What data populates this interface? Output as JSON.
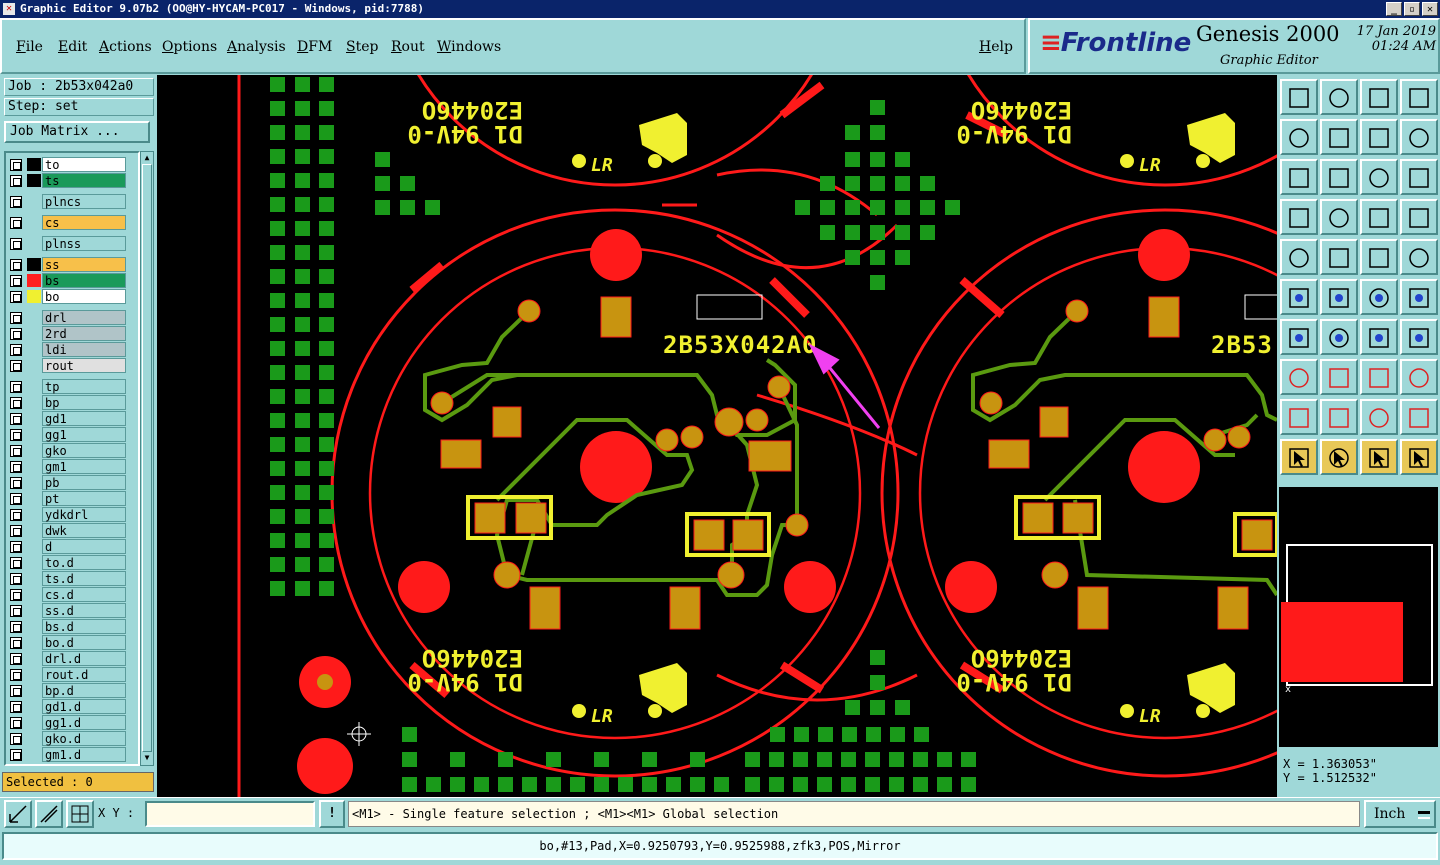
{
  "window": {
    "title": "Graphic Editor 9.07b2 (OO@HY-HYCAM-PC017 - Windows, pid:7788)",
    "min_label": "_",
    "max_label": "▫",
    "close_label": "✕"
  },
  "menu": {
    "file": "File",
    "edit": "Edit",
    "actions": "Actions",
    "options": "Options",
    "analysis": "Analysis",
    "dfm": "DFM",
    "step": "Step",
    "rout": "Rout",
    "windows": "Windows",
    "help": "Help"
  },
  "brand": {
    "logo": "Frontline",
    "product": "Genesis 2000",
    "subtitle": "Graphic Editor",
    "date": "17 Jan 2019",
    "time": "01:24 AM"
  },
  "job": {
    "job": "Job : 2b53x042a0",
    "step": "Step: set",
    "matrix_button": "Job Matrix ..."
  },
  "layers": [
    {
      "name": "to",
      "bg": "#ffffff",
      "swatch": "#000000"
    },
    {
      "name": "ts",
      "bg": "#1a9a5a",
      "swatch": "#000000"
    },
    {
      "name": "plncs",
      "bg": "#9fd8d8",
      "swatch": ""
    },
    {
      "name": "cs",
      "bg": "#f7c04a",
      "swatch": ""
    },
    {
      "name": "plnss",
      "bg": "#9fd8d8",
      "swatch": ""
    },
    {
      "name": "ss",
      "bg": "#f7c04a",
      "swatch": "#000000"
    },
    {
      "name": "bs",
      "bg": "#1a9a5a",
      "swatch": "#ff2020"
    },
    {
      "name": "bo",
      "bg": "#ffffff",
      "swatch": "#f0f030"
    },
    {
      "name": "drl",
      "bg": "#b0c4c8",
      "swatch": ""
    },
    {
      "name": "2rd",
      "bg": "#b0c4c8",
      "swatch": ""
    },
    {
      "name": "ldi",
      "bg": "#b0c4c8",
      "swatch": ""
    },
    {
      "name": "rout",
      "bg": "#e0e0e0",
      "swatch": ""
    },
    {
      "name": "tp",
      "bg": "#9fd8d8",
      "swatch": ""
    },
    {
      "name": "bp",
      "bg": "#9fd8d8",
      "swatch": ""
    },
    {
      "name": "gd1",
      "bg": "#9fd8d8",
      "swatch": ""
    },
    {
      "name": "gg1",
      "bg": "#9fd8d8",
      "swatch": ""
    },
    {
      "name": "gko",
      "bg": "#9fd8d8",
      "swatch": ""
    },
    {
      "name": "gm1",
      "bg": "#9fd8d8",
      "swatch": ""
    },
    {
      "name": "pb",
      "bg": "#9fd8d8",
      "swatch": ""
    },
    {
      "name": "pt",
      "bg": "#9fd8d8",
      "swatch": ""
    },
    {
      "name": "ydkdrl",
      "bg": "#9fd8d8",
      "swatch": ""
    },
    {
      "name": "dwk",
      "bg": "#9fd8d8",
      "swatch": ""
    },
    {
      "name": "d",
      "bg": "#9fd8d8",
      "swatch": ""
    },
    {
      "name": "to.d",
      "bg": "#9fd8d8",
      "swatch": ""
    },
    {
      "name": "ts.d",
      "bg": "#9fd8d8",
      "swatch": ""
    },
    {
      "name": "cs.d",
      "bg": "#9fd8d8",
      "swatch": ""
    },
    {
      "name": "ss.d",
      "bg": "#9fd8d8",
      "swatch": ""
    },
    {
      "name": "bs.d",
      "bg": "#9fd8d8",
      "swatch": ""
    },
    {
      "name": "bo.d",
      "bg": "#9fd8d8",
      "swatch": ""
    },
    {
      "name": "drl.d",
      "bg": "#9fd8d8",
      "swatch": ""
    },
    {
      "name": "rout.d",
      "bg": "#9fd8d8",
      "swatch": ""
    },
    {
      "name": "bp.d",
      "bg": "#9fd8d8",
      "swatch": ""
    },
    {
      "name": "gd1.d",
      "bg": "#9fd8d8",
      "swatch": ""
    },
    {
      "name": "gg1.d",
      "bg": "#9fd8d8",
      "swatch": ""
    },
    {
      "name": "gko.d",
      "bg": "#9fd8d8",
      "swatch": ""
    },
    {
      "name": "gm1.d",
      "bg": "#9fd8d8",
      "swatch": ""
    }
  ],
  "selected": "Selected : 0",
  "board": {
    "marking": "E20446O",
    "rating": "D1 94V-0",
    "ul_mark": "LR",
    "part_number": "2B53X042A0",
    "part_number_cut": "2B53",
    "colors": {
      "pad": "#ff1a1a",
      "trace": "#5a9a10",
      "smd": "#c89410",
      "silk": "#f0f030",
      "highlight": "#f040f0"
    }
  },
  "coords": {
    "x": "X = 1.363053\"",
    "y": "Y = 1.512532\""
  },
  "bottom": {
    "xy_label": "X Y :",
    "xy_value": "",
    "warn": "!",
    "hint": "<M1> - Single feature selection ; <M1><M1> Global selection",
    "unit": "Inch"
  },
  "status": "bo,#13,Pad,X=0.9250793,Y=0.9525988,zfk3,POS,Mirror"
}
